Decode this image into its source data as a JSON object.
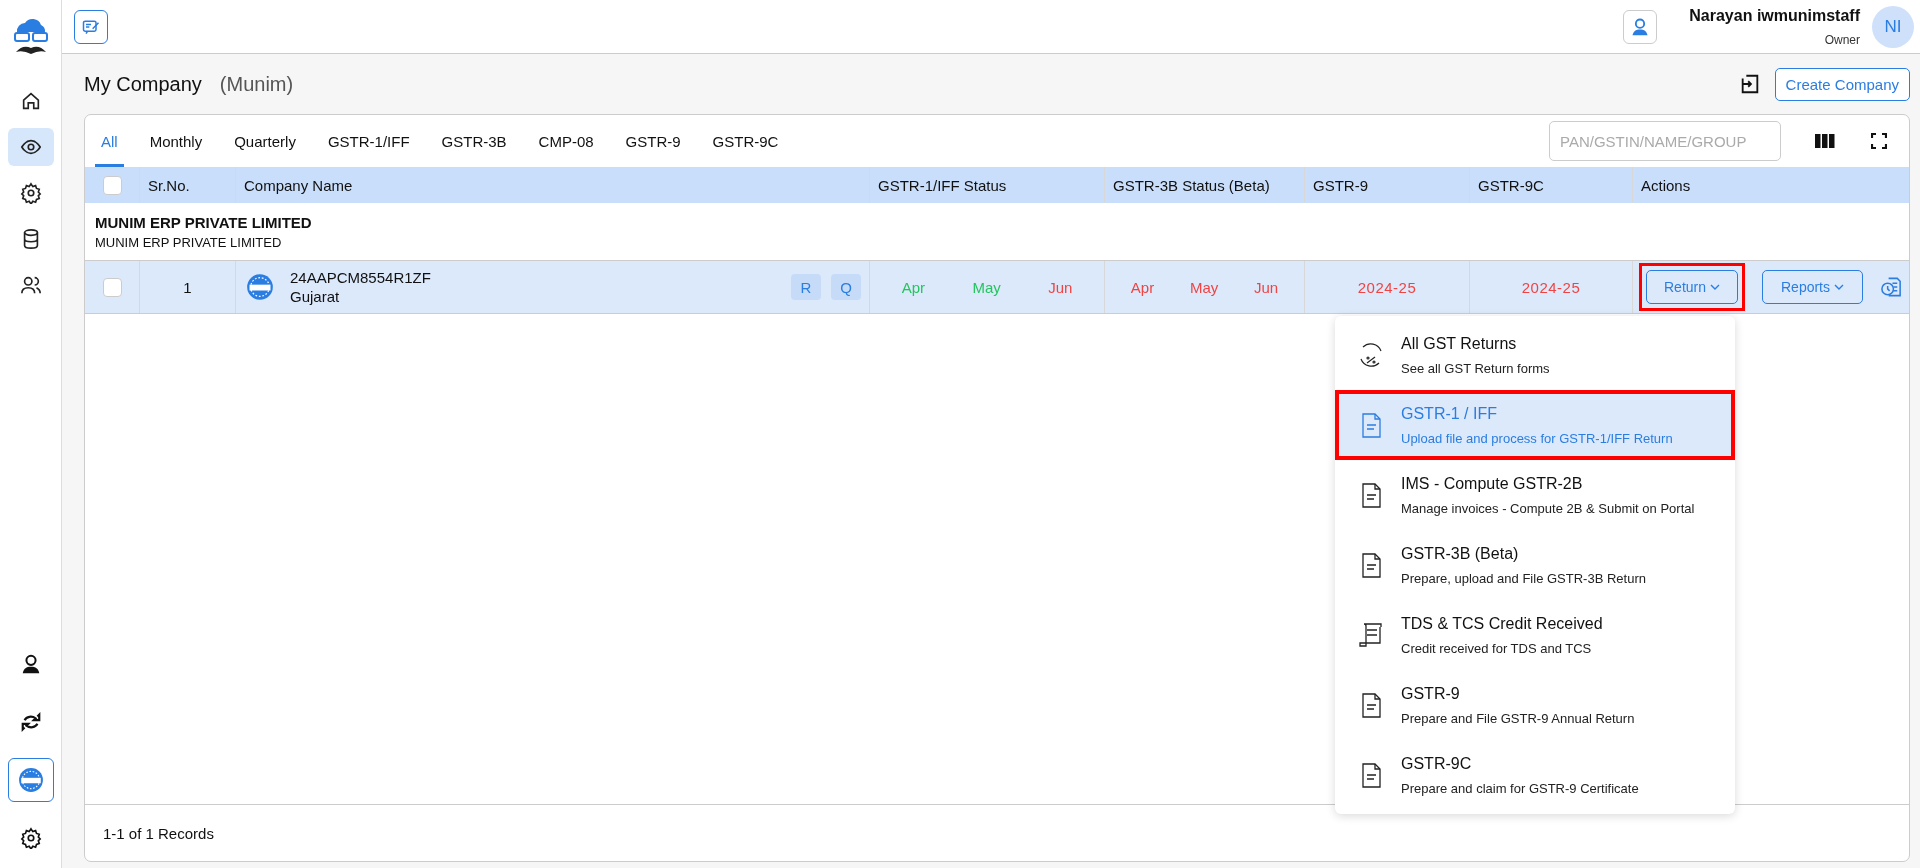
{
  "sidebar": {
    "top_items": [
      {
        "selected": false
      },
      {
        "selected": true
      },
      {
        "selected": false
      },
      {
        "selected": false
      },
      {
        "selected": false
      }
    ],
    "bottom_items": [
      {
        "selected": false
      },
      {
        "selected": false
      },
      {
        "selected": true
      },
      {
        "selected": false
      }
    ]
  },
  "header": {
    "user_name": "Narayan iwmunimstaff",
    "user_role": "Owner",
    "avatar_initials": "NI"
  },
  "page": {
    "title": "My Company",
    "subtitle": "(Munim)",
    "create_button": "Create Company"
  },
  "tabs": [
    {
      "label": "All",
      "selected": true
    },
    {
      "label": "Monthly",
      "selected": false
    },
    {
      "label": "Quarterly",
      "selected": false
    },
    {
      "label": "GSTR-1/IFF",
      "selected": false
    },
    {
      "label": "GSTR-3B",
      "selected": false
    },
    {
      "label": "CMP-08",
      "selected": false
    },
    {
      "label": "GSTR-9",
      "selected": false
    },
    {
      "label": "GSTR-9C",
      "selected": false
    }
  ],
  "search": {
    "placeholder": "PAN/GSTIN/NAME/GROUP"
  },
  "table": {
    "header_checked": false,
    "columns": [
      "Sr.No.",
      "Company Name",
      "GSTR-1/IFF Status",
      "GSTR-3B Status (Beta)",
      "GSTR-9",
      "GSTR-9C",
      "Actions"
    ],
    "group": {
      "title": "MUNIM ERP PRIVATE LIMITED",
      "subtitle": "MUNIM ERP PRIVATE LIMITED"
    },
    "rows": [
      {
        "checked": false,
        "sr_no": "1",
        "gstin": "24AAPCM8554R1ZF",
        "state": "Gujarat",
        "badges": [
          "R",
          "Q"
        ],
        "gstr1": [
          {
            "label": "Apr",
            "color": "#22c55e"
          },
          {
            "label": "May",
            "color": "#22c55e"
          },
          {
            "label": "Jun",
            "color": "#ef4444"
          }
        ],
        "gstr3b": [
          {
            "label": "Apr",
            "color": "#ef4444"
          },
          {
            "label": "May",
            "color": "#ef4444"
          },
          {
            "label": "Jun",
            "color": "#ef4444"
          }
        ],
        "gstr9": {
          "label": "2024-25",
          "color": "#ef4444"
        },
        "gstr9c": {
          "label": "2024-25",
          "color": "#ef4444"
        },
        "actions": [
          {
            "label": "Return",
            "highlighted": true
          },
          {
            "label": "Reports",
            "highlighted": false
          }
        ]
      }
    ]
  },
  "return_menu": [
    {
      "title": "All GST Returns",
      "description": "See all GST Return forms",
      "selected": false,
      "highlighted": false
    },
    {
      "title": "GSTR-1 / IFF",
      "description": "Upload file and process for GSTR-1/IFF Return",
      "selected": true,
      "highlighted": true
    },
    {
      "title": "IMS - Compute GSTR-2B",
      "description": "Manage invoices - Compute 2B & Submit on Portal",
      "selected": false,
      "highlighted": false
    },
    {
      "title": "GSTR-3B (Beta)",
      "description": "Prepare, upload and File GSTR-3B Return",
      "selected": false,
      "highlighted": false
    },
    {
      "title": "TDS & TCS Credit Received",
      "description": "Credit received for TDS and TCS",
      "selected": false,
      "highlighted": false
    },
    {
      "title": "GSTR-9",
      "description": "Prepare and File GSTR-9 Annual Return",
      "selected": false,
      "highlighted": false
    },
    {
      "title": "GSTR-9C",
      "description": "Prepare and claim for GSTR-9 Certificate",
      "selected": false,
      "highlighted": false
    }
  ],
  "footer": {
    "records": "1-1 of 1 Records"
  }
}
